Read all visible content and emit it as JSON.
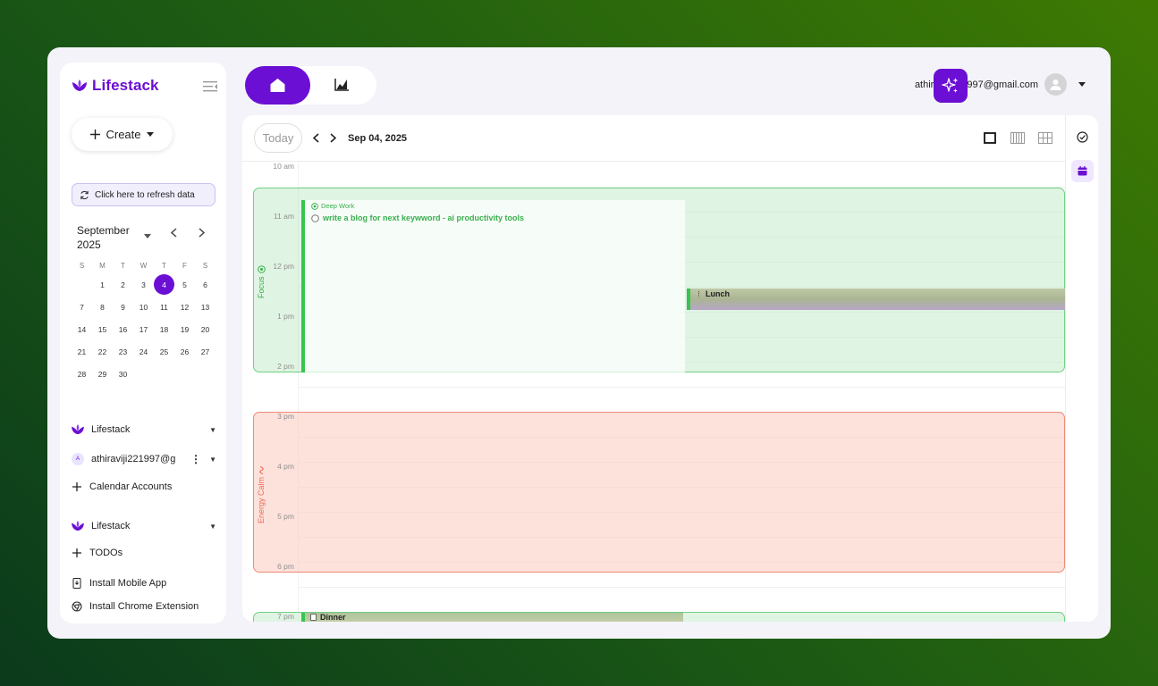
{
  "app": {
    "name": "Lifestack",
    "brand_color": "#6a0fd3"
  },
  "sidebar": {
    "create_label": "Create",
    "refresh_label": "Click here to refresh data",
    "calendar": {
      "month": "September",
      "year": "2025",
      "weekdays": [
        "S",
        "M",
        "T",
        "W",
        "T",
        "F",
        "S"
      ],
      "weeks": [
        [
          "",
          "1",
          "2",
          "3",
          "4",
          "5",
          "6"
        ],
        [
          "7",
          "8",
          "9",
          "10",
          "11",
          "12",
          "13"
        ],
        [
          "14",
          "15",
          "16",
          "17",
          "18",
          "19",
          "20"
        ],
        [
          "21",
          "22",
          "23",
          "24",
          "25",
          "26",
          "27"
        ],
        [
          "28",
          "29",
          "30",
          "",
          "",
          "",
          ""
        ]
      ],
      "selected_day": "4"
    },
    "items": {
      "lifestack_1": "Lifestack",
      "account_initial": "A",
      "account": "athiraviji221997@g",
      "calendar_accounts": "Calendar Accounts",
      "lifestack_2": "Lifestack",
      "todos": "TODOs",
      "install_mobile": "Install Mobile App",
      "install_chrome": "Install Chrome Extension"
    }
  },
  "header": {
    "user_email_start": "athir",
    "user_email_end": "997@gmail.com"
  },
  "toolbar": {
    "today_label": "Today",
    "date": "Sep 04, 2025"
  },
  "timeline": {
    "hours": [
      "10 am",
      "11 am",
      "12 pm",
      "1 pm",
      "2 pm",
      "3 pm",
      "4 pm",
      "5 pm",
      "6 pm",
      "7 pm"
    ],
    "blocks": {
      "focus_label": "Focus",
      "energy_label": "Energy Calm"
    },
    "events": {
      "deep_work_title": "Deep Work",
      "deep_work_task": "write a blog for next keywword - ai productivity tools",
      "lunch": "Lunch",
      "dinner": "Dinner"
    }
  }
}
